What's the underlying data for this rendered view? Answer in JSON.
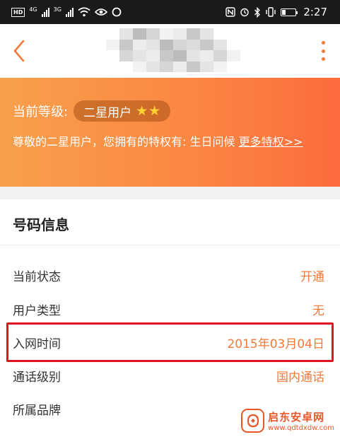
{
  "status_bar": {
    "hd_label": "HD",
    "net_label_1": "4G",
    "net_label_2": "3G",
    "time": "2:27",
    "icons": [
      "nfc-icon",
      "alarm-icon",
      "bluetooth-icon",
      "vibrate-icon",
      "battery-icon",
      "wifi-icon",
      "eye-icon",
      "circle-icon"
    ]
  },
  "header": {
    "back_icon": "chevron-left-icon",
    "more_icon": "more-vertical-icon",
    "accent_color": "#f07a3c"
  },
  "banner": {
    "level_label": "当前等级:",
    "level_value": "二星用户",
    "star_count": 2,
    "star_glyph": "★",
    "privilege_text": "尊敬的二星用户，您拥有的特权有: 生日问候 ",
    "more_link": "更多特权>>"
  },
  "number_info": {
    "title": "号码信息",
    "rows": [
      {
        "label": "当前状态",
        "value": "开通"
      },
      {
        "label": "用户类型",
        "value": "无"
      },
      {
        "label": "入网时间",
        "value": "2015年03月04日"
      },
      {
        "label": "通话级别",
        "value": "国内通话"
      },
      {
        "label": "所属品牌",
        "value": ""
      }
    ],
    "highlight_color": "#e0141e"
  },
  "watermark": {
    "name": "启东安卓网",
    "url": "www.qdtdxdw.com"
  }
}
